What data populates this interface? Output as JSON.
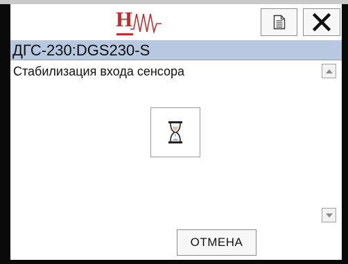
{
  "header": {
    "logo_text": "H",
    "document_icon": "document-icon",
    "close_icon": "close-icon"
  },
  "title_bar": {
    "device": "ДГС-230:DGS230-S"
  },
  "content": {
    "status_message": "Стабилизация входа сенсора",
    "busy_icon": "hourglass-icon",
    "scroll_up_icon": "triangle-up-icon",
    "scroll_down_icon": "triangle-down-icon"
  },
  "footer": {
    "cancel_label": "ОТМЕНА"
  },
  "colors": {
    "logo_red": "#c62a2a",
    "title_bar": "#b8c8e0",
    "frame": "#0a0a0a"
  }
}
